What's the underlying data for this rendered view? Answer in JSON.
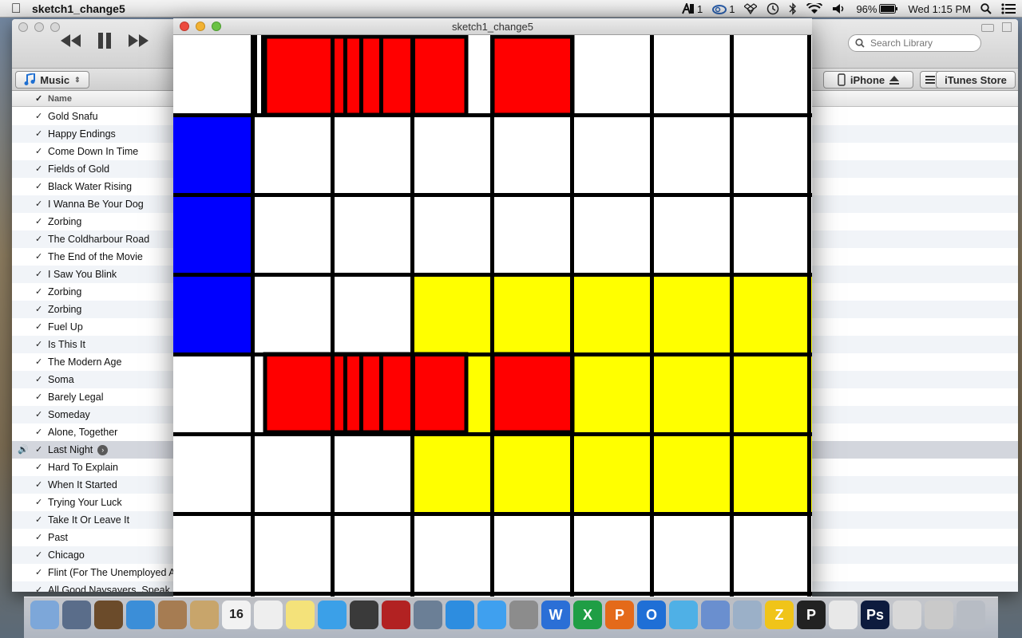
{
  "menubar": {
    "app_name": "sketch1_change5",
    "adobe_count": "1",
    "cc_count": "1",
    "battery": "96%",
    "clock": "Wed 1:15 PM"
  },
  "itunes": {
    "source_label": "Music",
    "search_placeholder": "Search Library",
    "device_label": "iPhone",
    "store_label": "iTunes Store",
    "column_name": "Name",
    "songs": [
      "Gold Snafu",
      "Happy Endings",
      "Come Down In Time",
      "Fields of Gold",
      "Black Water Rising",
      "I Wanna Be Your Dog",
      "Zorbing",
      "The Coldharbour Road",
      "The End of the Movie",
      "I Saw You Blink",
      "Zorbing",
      "Zorbing",
      "Fuel Up",
      "Is This It",
      "The Modern Age",
      "Soma",
      "Barely Legal",
      "Someday",
      "Alone, Together",
      "Last Night",
      "Hard To Explain",
      "When It Started",
      "Trying Your Luck",
      "Take It Or Leave It",
      "Past",
      "Chicago",
      "Flint (For The Unemployed An",
      "All Good Naysayers, Speak U"
    ],
    "now_playing": "Last Night"
  },
  "sketch_window": {
    "title": "sketch1_change5",
    "colors": {
      "red": "#ff0000",
      "blue": "#0000ff",
      "yellow": "#ffff00",
      "line": "#000000",
      "white": "#ffffff"
    }
  },
  "dock": {
    "calendar_day": "16",
    "icons": [
      "finder-icon",
      "launchpad-icon",
      "preview-icon",
      "safari-icon",
      "mail-stamp-icon",
      "contacts-icon",
      "calendar-icon",
      "reminders-icon",
      "notes-icon",
      "messages-icon",
      "facetime-icon",
      "photo-booth-icon",
      "iphoto-icon",
      "itunes-icon",
      "app-store-icon",
      "system-preferences-icon",
      "word-icon",
      "excel-icon",
      "powerpoint-icon",
      "outlook-icon",
      "messenger-icon",
      "migration-icon",
      "preview2-icon",
      "zotero-icon",
      "processing-icon",
      "github-icon",
      "photoshop-icon",
      "java-icon",
      "documents-icon",
      "trash-icon"
    ]
  }
}
